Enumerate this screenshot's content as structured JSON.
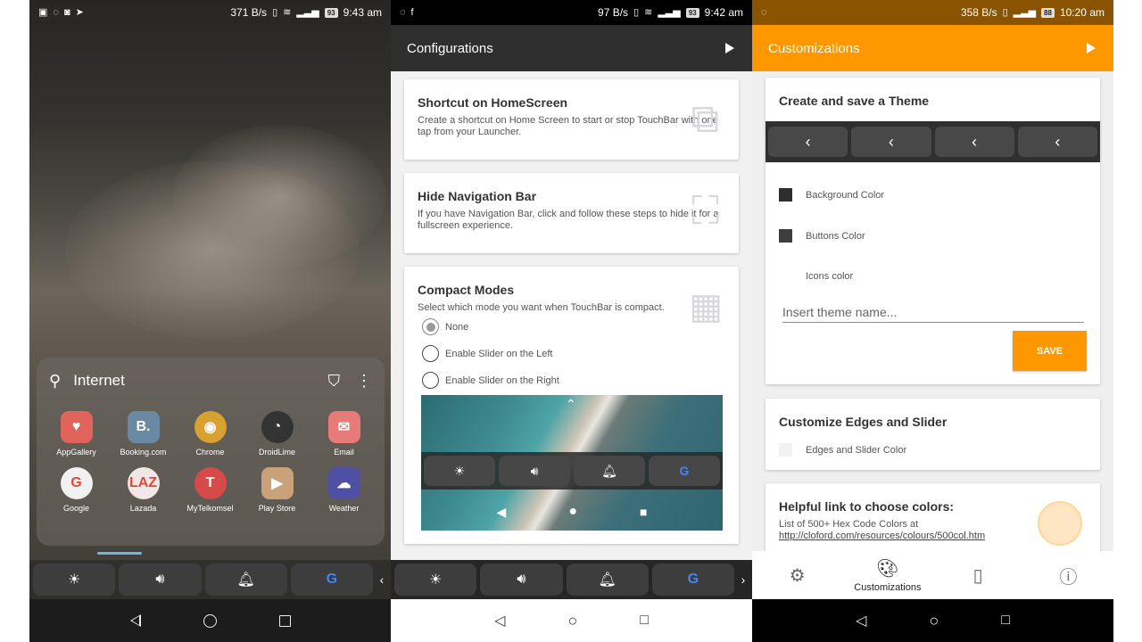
{
  "panel1": {
    "status": {
      "left_icons": [
        "gallery-icon",
        "whatsapp-icon",
        "instagram-icon",
        "arrow-icon"
      ],
      "speed": "371 B/s",
      "battery": "93",
      "time": "9:43 am"
    },
    "drawer": {
      "title": "Internet",
      "apps": [
        {
          "label": "AppGallery",
          "color": "#e0645c",
          "glyph": "♥"
        },
        {
          "label": "Booking.com",
          "color": "#6a8aa3",
          "glyph": "B."
        },
        {
          "label": "Chrome",
          "color": "#d9a032",
          "glyph": "◉"
        },
        {
          "label": "DroidLime",
          "color": "#333333",
          "glyph": "◔"
        },
        {
          "label": "Email",
          "color": "#e87a7a",
          "glyph": "✉"
        },
        {
          "label": "Google",
          "color": "#f1f1f1",
          "glyph": "G"
        },
        {
          "label": "Lazada",
          "color": "#f2e6e6",
          "glyph": "LAZ"
        },
        {
          "label": "MyTelkomsel",
          "color": "#d64a4a",
          "glyph": "T"
        },
        {
          "label": "Play Store",
          "color": "#c9a27a",
          "glyph": "▶"
        },
        {
          "label": "Weather",
          "color": "#4f4fa3",
          "glyph": "☁"
        }
      ]
    }
  },
  "panel2": {
    "status": {
      "speed": "97 B/s",
      "battery": "93",
      "time": "9:42 am"
    },
    "title": "Configurations",
    "colors": {
      "appbar": "#2f2f2f"
    },
    "cards": {
      "shortcut": {
        "title": "Shortcut on HomeScreen",
        "desc": "Create a shortcut on Home Screen to start or stop TouchBar with one tap from your Launcher."
      },
      "hidenav": {
        "title": "Hide Navigation Bar",
        "desc": "If you have Navigation Bar, click and follow these steps to hide it for a fullscreen experience."
      },
      "compact": {
        "title": "Compact Modes",
        "desc": "Select which mode you want when TouchBar is compact.",
        "options": [
          "None",
          "Enable Slider on the Left",
          "Enable Slider on the Right"
        ],
        "selected": 0
      }
    }
  },
  "panel3": {
    "status": {
      "speed": "358 B/s",
      "battery": "88",
      "time": "10:20 am"
    },
    "title": "Customizations",
    "colors": {
      "appbar": "#ff9800",
      "background_swatch": "#2e2e2e",
      "buttons_swatch": "#3e3e3e"
    },
    "theme_card": {
      "title": "Create and save a Theme",
      "options": [
        "Background Color",
        "Buttons Color",
        "Icons color"
      ],
      "input_placeholder": "Insert theme name...",
      "save_label": "SAVE"
    },
    "edges_card": {
      "title": "Customize Edges and Slider",
      "option": "Edges and Slider Color"
    },
    "help_card": {
      "title": "Helpful link to choose colors:",
      "desc": "List of 500+ Hex Code Colors at",
      "link": "http://cloford.com/resources/colours/500col.htm"
    },
    "bottom_nav": {
      "active_label": "Customizations"
    }
  }
}
